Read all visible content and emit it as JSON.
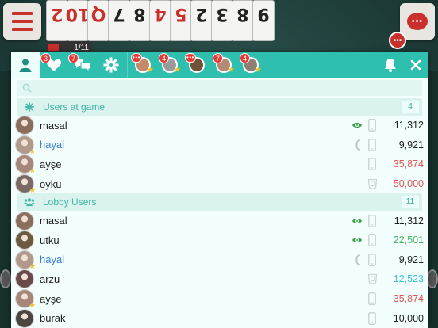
{
  "game": {
    "cards": [
      {
        "rank": "2",
        "red": true
      },
      {
        "rank": "10",
        "red": true
      },
      {
        "rank": "Q",
        "red": true
      },
      {
        "rank": "7",
        "red": false
      },
      {
        "rank": "8",
        "red": false
      },
      {
        "rank": "4",
        "red": true
      },
      {
        "rank": "5",
        "red": true
      },
      {
        "rank": "2",
        "red": false
      },
      {
        "rank": "3",
        "red": false
      },
      {
        "rank": "8",
        "red": false
      },
      {
        "rank": "9",
        "red": false
      }
    ],
    "score_label": "1/11",
    "notification_dots": "•••"
  },
  "tabs": {
    "friends_badge": "3",
    "messages_badge": "7",
    "chats": [
      {
        "badge": "•••",
        "color": "#c48a6a",
        "starred": true
      },
      {
        "badge": "4",
        "color": "#9a9a9a",
        "starred": true
      },
      {
        "badge": "•••",
        "color": "#6e5138",
        "starred": false
      },
      {
        "badge": "7",
        "color": "#b58a72",
        "starred": true
      },
      {
        "badge": "4",
        "color": "#8f7f73",
        "starred": true
      }
    ]
  },
  "search": {
    "placeholder": ""
  },
  "users_at_game": {
    "title": "Users at game",
    "count": "4",
    "rows": [
      {
        "name": "masal",
        "style": "",
        "status": "eye",
        "chips": "11,312",
        "chip_style": "",
        "device": "phone",
        "avatar": "#8c6e5d",
        "star": false
      },
      {
        "name": "hayal",
        "style": "blue",
        "status": "phone-call",
        "chips": "9,921",
        "chip_style": "",
        "device": "phone",
        "avatar": "#b09a8c",
        "star": true
      },
      {
        "name": "ayşe",
        "style": "",
        "status": "",
        "chips": "35,874",
        "chip_style": "red",
        "device": "phone",
        "avatar": "#a6877a",
        "star": true
      },
      {
        "name": "öykü",
        "style": "",
        "status": "",
        "chips": "50,000",
        "chip_style": "red",
        "device": "html5",
        "avatar": "#7b6a63",
        "star": true
      }
    ]
  },
  "lobby_users": {
    "title": "Lobby Users",
    "count": "11",
    "rows": [
      {
        "name": "masal",
        "style": "",
        "status": "eye",
        "chips": "11,312",
        "chip_style": "",
        "device": "phone",
        "avatar": "#8c6e5d",
        "star": false
      },
      {
        "name": "utku",
        "style": "",
        "status": "eye",
        "chips": "22,501",
        "chip_style": "green",
        "device": "phone",
        "avatar": "#6d5a40",
        "star": false
      },
      {
        "name": "hayal",
        "style": "blue",
        "status": "phone-call",
        "chips": "9,921",
        "chip_style": "",
        "device": "phone",
        "avatar": "#b09a8c",
        "star": true
      },
      {
        "name": "arzu",
        "style": "",
        "status": "",
        "chips": "12,523",
        "chip_style": "cyan",
        "device": "html5",
        "avatar": "#6a4a48",
        "star": false
      },
      {
        "name": "ayşe",
        "style": "",
        "status": "",
        "chips": "35,874",
        "chip_style": "red",
        "device": "phone",
        "avatar": "#a6877a",
        "star": true
      },
      {
        "name": "burak",
        "style": "",
        "status": "",
        "chips": "10,000",
        "chip_style": "",
        "device": "phone",
        "avatar": "#4d4540",
        "star": false
      }
    ]
  }
}
